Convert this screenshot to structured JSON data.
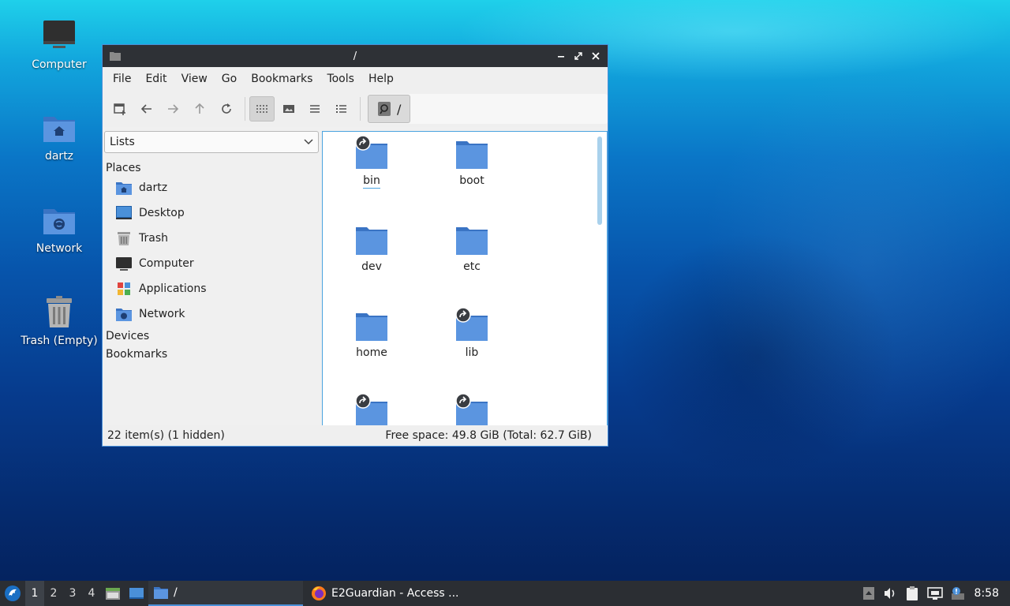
{
  "desktop": {
    "icons": [
      {
        "label": "Computer"
      },
      {
        "label": "dartz"
      },
      {
        "label": "Network"
      },
      {
        "label": "Trash (Empty)"
      }
    ]
  },
  "window": {
    "title": "/",
    "menu": [
      "File",
      "Edit",
      "View",
      "Go",
      "Bookmarks",
      "Tools",
      "Help"
    ],
    "location_path": "/",
    "sidebar": {
      "selector": "Lists",
      "places_heading": "Places",
      "places": [
        {
          "label": "dartz",
          "icon": "home-folder-icon"
        },
        {
          "label": "Desktop",
          "icon": "desktop-icon"
        },
        {
          "label": "Trash",
          "icon": "trash-icon"
        },
        {
          "label": "Computer",
          "icon": "computer-icon"
        },
        {
          "label": "Applications",
          "icon": "applications-icon"
        },
        {
          "label": "Network",
          "icon": "network-icon"
        }
      ],
      "devices_heading": "Devices",
      "bookmarks_heading": "Bookmarks"
    },
    "files": [
      {
        "name": "bin",
        "symlink": true
      },
      {
        "name": "boot",
        "symlink": false
      },
      {
        "name": "dev",
        "symlink": false
      },
      {
        "name": "etc",
        "symlink": false
      },
      {
        "name": "home",
        "symlink": false
      },
      {
        "name": "lib",
        "symlink": true
      },
      {
        "name": "",
        "symlink": true
      },
      {
        "name": "",
        "symlink": true
      }
    ],
    "status": {
      "items": "22 item(s) (1 hidden)",
      "free_space": "Free space: 49.8 GiB (Total: 62.7 GiB)"
    }
  },
  "taskbar": {
    "workspaces": [
      "1",
      "2",
      "3",
      "4"
    ],
    "active_task": "/",
    "app_task": "E2Guardian - Access ...",
    "clock": "8:58"
  },
  "colors": {
    "folder": "#4a86d6",
    "folder_light": "#6fa3e6",
    "accent": "#4a90d9"
  }
}
